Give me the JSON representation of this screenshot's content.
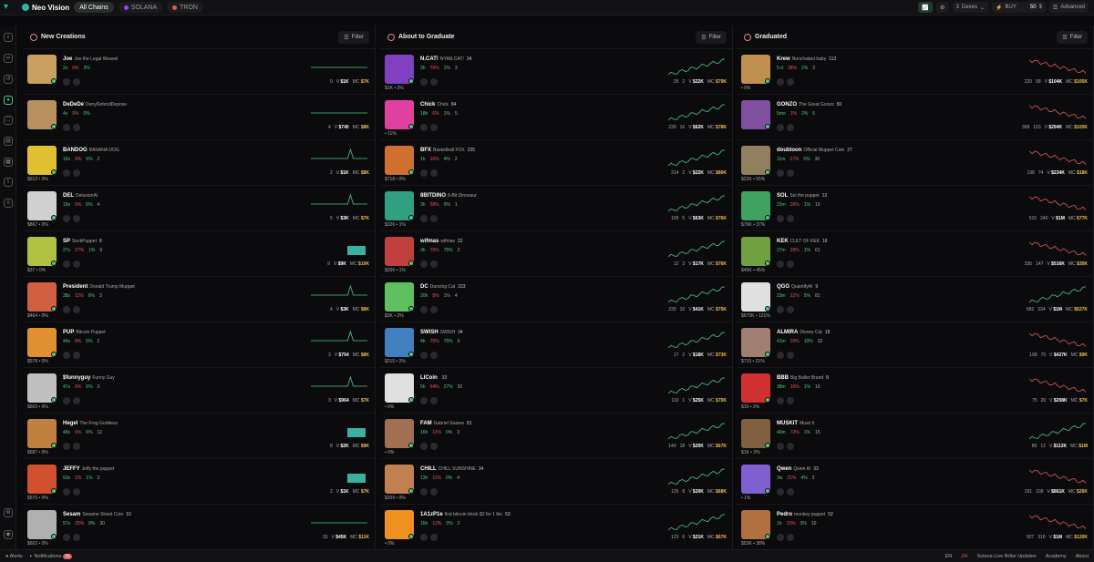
{
  "topbar": {
    "brand": "Neo Vision",
    "chains": [
      {
        "label": "All Chains",
        "active": true,
        "color": "#4ec98a"
      },
      {
        "label": "SOLANA",
        "active": false,
        "color": "#9945ff"
      },
      {
        "label": "TRON",
        "active": false,
        "color": "#e05a5a"
      }
    ],
    "dexes_label": "Dexes",
    "dexes_count": "3",
    "buy_label": "BUY",
    "buy_amount": "50",
    "buy_unit": "$",
    "advanced_label": "Advanced"
  },
  "columns": [
    {
      "title": "New Creations",
      "filter": "Filter",
      "rows": [
        {
          "ticker": "Joe",
          "name": "Joe the Legal Weasel",
          "age": "2s",
          "top": "0%",
          "dev": "3%",
          "holders": "",
          "sub": "",
          "holders_n": "0",
          "vol": "$1K",
          "mc": "$7K",
          "color": "#c9a060",
          "chart": "flat"
        },
        {
          "ticker": "DeDeDe",
          "name": "DenyDefendDepose",
          "age": "4s",
          "top": "9%",
          "dev": "0%",
          "holders": "",
          "sub": "",
          "holders_n": "4",
          "vol": "$740",
          "mc": "$8K",
          "color": "#b89060",
          "chart": "flat"
        },
        {
          "ticker": "BANDOG",
          "name": "BANANA DOG",
          "age": "16s",
          "top": "9%",
          "dev": "5%",
          "holders": "2",
          "sub": "$913 • 0%",
          "holders_n": "2",
          "vol": "$1K",
          "mc": "$8K",
          "color": "#e0c030",
          "chart": "spike"
        },
        {
          "ticker": "DEL",
          "name": "DelusionAI",
          "age": "19s",
          "top": "6%",
          "dev": "6%",
          "holders": "4",
          "sub": "$867 • 0%",
          "holders_n": "5",
          "vol": "$3K",
          "mc": "$7K",
          "color": "#d0d0d0",
          "chart": "spike"
        },
        {
          "ticker": "SP",
          "name": "SockPuppet",
          "age": "27s",
          "top": "27%",
          "dev": "1%",
          "holders": "9",
          "sub": "$37 • 0%",
          "holders_n": "9",
          "vol": "$9K",
          "mc": "$10K",
          "color": "#b0c040",
          "chart": "bar",
          "subh": "8"
        },
        {
          "ticker": "President",
          "name": "Donald Trump Muppet",
          "age": "38s",
          "top": "11%",
          "dev": "6%",
          "holders": "3",
          "sub": "$464 • 0%",
          "holders_n": "4",
          "vol": "$3K",
          "mc": "$8K",
          "color": "#d06040",
          "chart": "spike"
        },
        {
          "ticker": "PUP",
          "name": "Bitcoin Puppet",
          "age": "44s",
          "top": "8%",
          "dev": "5%",
          "holders": "2",
          "sub": "$578 • 0%",
          "holders_n": "3",
          "vol": "$754",
          "mc": "$8K",
          "color": "#e09030",
          "chart": "spike"
        },
        {
          "ticker": "$funnyguy",
          "name": "Funny Guy",
          "age": "47s",
          "top": "6%",
          "dev": "6%",
          "holders": "3",
          "sub": "$603 • 0%",
          "holders_n": "3",
          "vol": "$964",
          "mc": "$7K",
          "color": "#c0c0c0",
          "chart": "spike"
        },
        {
          "ticker": "Hegel",
          "name": "The Frog Goddess",
          "age": "48s",
          "top": "6%",
          "dev": "6%",
          "holders": "12",
          "sub": "$687 • 0%",
          "holders_n": "8",
          "vol": "$2K",
          "mc": "$9K",
          "color": "#c08040",
          "chart": "bar"
        },
        {
          "ticker": "JEFFY",
          "name": "Jeffy the puppet",
          "age": "53s",
          "top": "1%",
          "dev": "1%",
          "holders": "3",
          "sub": "$570 • 0%",
          "holders_n": "2",
          "vol": "$1K",
          "mc": "$7K",
          "color": "#d05030",
          "chart": "bar"
        },
        {
          "ticker": "Sesam",
          "name": "Sesame Street Coin",
          "age": "57s",
          "top": "25%",
          "dev": "8%",
          "holders": "30",
          "sub": "$602 • 0%",
          "holders_n": "33",
          "vol": "$45K",
          "mc": "$11K",
          "color": "#b0b0b0",
          "chart": "flat",
          "subh": "10"
        }
      ]
    },
    {
      "title": "About to Graduate",
      "filter": "Filter",
      "rows": [
        {
          "ticker": "N.CAT!",
          "name": "NYAN.CAT!",
          "age": "3h",
          "top": "76%",
          "dev": "1%",
          "holders": "3",
          "sub": "$1K • 3%",
          "holders_n": "25",
          "vol": "$22K",
          "mc": "$79K",
          "color": "#8040c0",
          "chart": "up",
          "subh": "34",
          "buys": "2"
        },
        {
          "ticker": "Chick",
          "name": "Chick",
          "age": "18h",
          "top": "6%",
          "dev": "1%",
          "holders": "5",
          "sub": "• 11%",
          "holders_n": "239",
          "vol": "$62K",
          "mc": "$78K",
          "color": "#e040a0",
          "chart": "up",
          "subh": "84",
          "buys": "16"
        },
        {
          "ticker": "BFX",
          "name": "Basketball FOX",
          "age": "1h",
          "top": "10%",
          "dev": "4%",
          "holders": "2",
          "sub": "$718 • 0%",
          "holders_n": "214",
          "vol": "$22K",
          "mc": "$80K",
          "color": "#d07030",
          "chart": "up",
          "subh": "225",
          "buys": "2"
        },
        {
          "ticker": "8BITDINO",
          "name": "8-Bit Dinosaur",
          "age": "3h",
          "top": "58%",
          "dev": "0%",
          "holders": "1",
          "sub": "$326 • 1%",
          "holders_n": "100",
          "vol": "$63K",
          "mc": "$76K",
          "color": "#30a080",
          "chart": "up",
          "buys": "5"
        },
        {
          "ticker": "wifmas",
          "name": "wifmas",
          "age": "3h",
          "top": "76%",
          "dev": "75%",
          "holders": "2",
          "sub": "$256 • 1%",
          "holders_n": "12",
          "vol": "$17K",
          "mc": "$76K",
          "color": "#c04040",
          "chart": "up",
          "subh": "22",
          "buys": "3"
        },
        {
          "ticker": "DC",
          "name": "Dancing Cat",
          "age": "20h",
          "top": "8%",
          "dev": "1%",
          "holders": "4",
          "sub": "$3K • 2%",
          "holders_n": "230",
          "vol": "$41K",
          "mc": "$75K",
          "color": "#60c060",
          "chart": "up",
          "subh": "223",
          "buys": "10"
        },
        {
          "ticker": "SWISH",
          "name": "SWISH",
          "age": "4h",
          "top": "75%",
          "dev": "75%",
          "holders": "6",
          "sub": "$215 • 2%",
          "holders_n": "17",
          "vol": "$18K",
          "mc": "$73K",
          "color": "#4080c0",
          "chart": "up",
          "subh": "34",
          "buys": "2"
        },
        {
          "ticker": "LICoin",
          "name": "",
          "age": "5h",
          "top": "64%",
          "dev": "27%",
          "holders": "20",
          "sub": "• 0%",
          "holders_n": "110",
          "vol": "$25K",
          "mc": "$70K",
          "color": "#e0e0e0",
          "chart": "up",
          "subh": "33",
          "buys": "1"
        },
        {
          "ticker": "FAM",
          "name": "Gabriel Soares",
          "age": "16h",
          "top": "11%",
          "dev": "0%",
          "holders": "3",
          "sub": "• 0%",
          "holders_n": "140",
          "vol": "$20K",
          "mc": "$67K",
          "color": "#a07050",
          "chart": "up",
          "subh": "81",
          "buys": "18"
        },
        {
          "ticker": "CHILL",
          "name": "CHILL SUNSHINE",
          "age": "13h",
          "top": "11%",
          "dev": "0%",
          "holders": "4",
          "sub": "$209 • 0%",
          "holders_n": "125",
          "vol": "$20K",
          "mc": "$68K",
          "color": "#c08050",
          "chart": "up",
          "subh": "34",
          "buys": "8"
        },
        {
          "ticker": "1A1zP1e",
          "name": "first bitcoin block $2 for 1 btc",
          "age": "16h",
          "top": "12%",
          "dev": "0%",
          "holders": "2",
          "sub": "• 0%",
          "holders_n": "123",
          "vol": "$21K",
          "mc": "$67K",
          "color": "#f09020",
          "chart": "up",
          "subh": "53",
          "buys": "6"
        }
      ]
    },
    {
      "title": "Graduated",
      "filter": "Filter",
      "rows": [
        {
          "ticker": "Krew",
          "name": "Nonchalant baby",
          "age": "5 d",
          "top": "28%",
          "dev": "2%",
          "holders": "3",
          "sub": "• 0%",
          "holders_n": "220",
          "vol": "$104K",
          "mc": "$105K",
          "color": "#c09050",
          "chart": "down",
          "subh": "113",
          "buys": "68"
        },
        {
          "ticker": "GONZO",
          "name": "The Great Gonzo",
          "age": "5mo",
          "top": "1%",
          "dev": "2%",
          "holders": "5",
          "sub": "",
          "holders_n": "368",
          "vol": "$294K",
          "mc": "$100K",
          "color": "#8050a0",
          "chart": "down",
          "subh": "50",
          "buys": "153"
        },
        {
          "ticker": "doubloon",
          "name": "Official Muppet Coin",
          "age": "11m",
          "top": "27%",
          "dev": "5%",
          "holders": "30",
          "sub": "$22K • 55%",
          "holders_n": "138",
          "vol": "$234K",
          "mc": "$18K",
          "color": "#908060",
          "chart": "down",
          "subh": "27",
          "buys": "74"
        },
        {
          "ticker": "SOL",
          "name": "Sol the puppet",
          "age": "23m",
          "top": "26%",
          "dev": "1%",
          "holders": "19",
          "sub": "$79K • 37%",
          "holders_n": "515",
          "vol": "$1M",
          "mc": "$77K",
          "color": "#40a060",
          "chart": "down",
          "subh": "13",
          "buys": "240"
        },
        {
          "ticker": "KEK",
          "name": "CULT OF KEK",
          "age": "27m",
          "top": "28%",
          "dev": "1%",
          "holders": "61",
          "sub": "$49K • 45%",
          "holders_n": "335",
          "vol": "$516K",
          "mc": "$35K",
          "color": "#70a040",
          "chart": "down",
          "subh": "16",
          "buys": "147"
        },
        {
          "ticker": "QGG",
          "name": "QuantifyAI",
          "age": "23m",
          "top": "22%",
          "dev": "5%",
          "holders": "81",
          "sub": "$670K • 121%",
          "holders_n": "682",
          "vol": "$1M",
          "mc": "$627K",
          "color": "#e0e0e0",
          "chart": "up",
          "subh": "9",
          "buys": "334"
        },
        {
          "ticker": "ALMIRA",
          "name": "Disney Cat",
          "age": "41m",
          "top": "20%",
          "dev": "10%",
          "holders": "32",
          "sub": "$715 • 21%",
          "holders_n": "198",
          "vol": "$427K",
          "mc": "$9K",
          "color": "#a08070",
          "chart": "down",
          "subh": "18",
          "buys": "75"
        },
        {
          "ticker": "BBB",
          "name": "Big Baller Brand",
          "age": "38m",
          "top": "15%",
          "dev": "1%",
          "holders": "19",
          "sub": "$16 • 2%",
          "holders_n": "75",
          "vol": "$208K",
          "mc": "$7K",
          "color": "#d03030",
          "chart": "down",
          "subh": "8",
          "buys": "20"
        },
        {
          "ticker": "MUSKIT",
          "name": "Musk It",
          "age": "40m",
          "top": "72%",
          "dev": "1%",
          "holders": "15",
          "sub": "$1K • 2%",
          "holders_n": "89",
          "vol": "$112K",
          "mc": "$1M",
          "color": "#806040",
          "chart": "up",
          "buys": "12"
        },
        {
          "ticker": "Qwen",
          "name": "Qwen AI",
          "age": "3w",
          "top": "21%",
          "dev": "4%",
          "holders": "3",
          "sub": "• 1%",
          "holders_n": "291",
          "vol": "$861K",
          "mc": "$26K",
          "color": "#8060d0",
          "chart": "down",
          "subh": "33",
          "buys": "109"
        },
        {
          "ticker": "Pedro",
          "name": "monkey puppet",
          "age": "1h",
          "top": "15%",
          "dev": "3%",
          "holders": "10",
          "sub": "$53K • 38%",
          "holders_n": "927",
          "vol": "$1M",
          "mc": "$120K",
          "color": "#b07040",
          "chart": "down",
          "subh": "52",
          "buys": "318"
        }
      ]
    }
  ],
  "bottombar": {
    "alerts": "Alerts",
    "notifications": "Notifications",
    "notif_count": "15",
    "lang": "EN",
    "lang2": "ZH",
    "updates": "Solana Live Bribe Updates",
    "academy": "Academy",
    "about": "About"
  },
  "colors": {
    "accent": "#4ec98a",
    "negative": "#e05a5a",
    "bg": "#0a0a0c"
  }
}
